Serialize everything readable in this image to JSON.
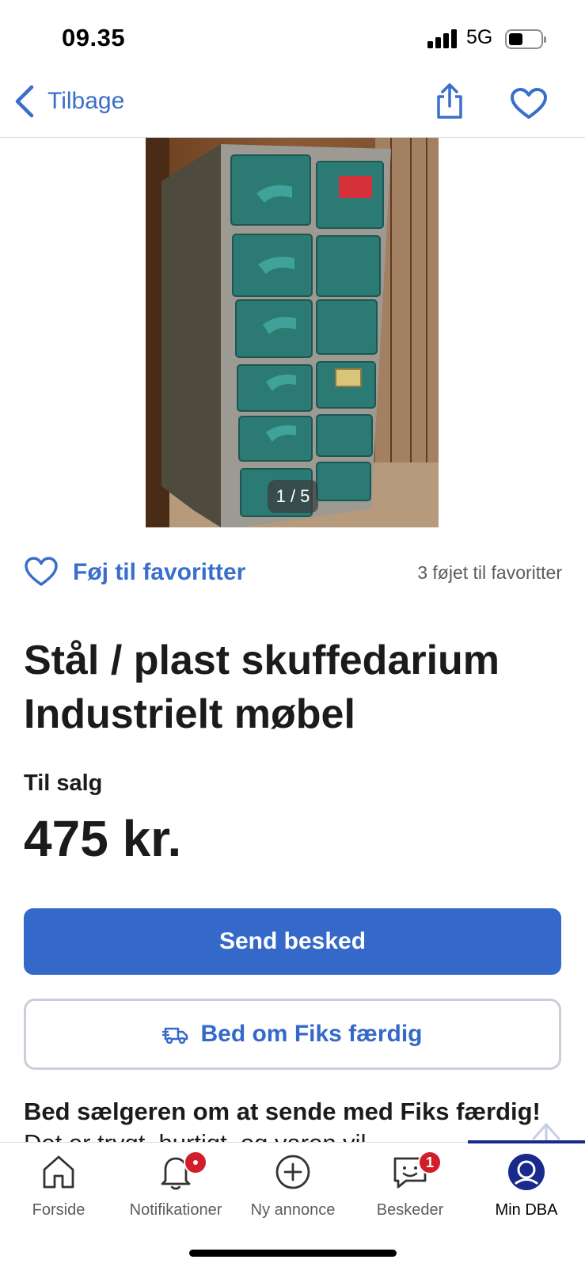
{
  "status_bar": {
    "time": "09.35",
    "network": "5G"
  },
  "nav": {
    "back_label": "Tilbage",
    "share_icon": "share-icon",
    "favorite_icon": "heart-icon"
  },
  "listing": {
    "image_counter": "1 / 5",
    "favorite_label": "Føj til favoritter",
    "favorite_count_text": "3 føjet til favoritter",
    "title": "Stål / plast skuffedarium Industrielt møbel",
    "sale_type": "Til salg",
    "price": "475 kr.",
    "primary_button": "Send besked",
    "secondary_button": "Bed om Fiks færdig",
    "fiks_heading": "Bed sælgeren om at sende med Fiks færdig!",
    "fiks_body": " Det er trygt, hurtigt, og varen vil"
  },
  "tabbar": {
    "tabs": [
      {
        "label": "Forside",
        "icon": "home-icon"
      },
      {
        "label": "Notifikationer",
        "icon": "bell-icon",
        "badge": ""
      },
      {
        "label": "Ny annonce",
        "icon": "plus-circle-icon"
      },
      {
        "label": "Beskeder",
        "icon": "chat-icon",
        "badge": "1"
      },
      {
        "label": "Min DBA",
        "icon": "profile-icon",
        "active": true
      }
    ]
  },
  "colors": {
    "accent": "#3569c9",
    "badge": "#d21e2b",
    "active_tab": "#1a2a8c"
  }
}
